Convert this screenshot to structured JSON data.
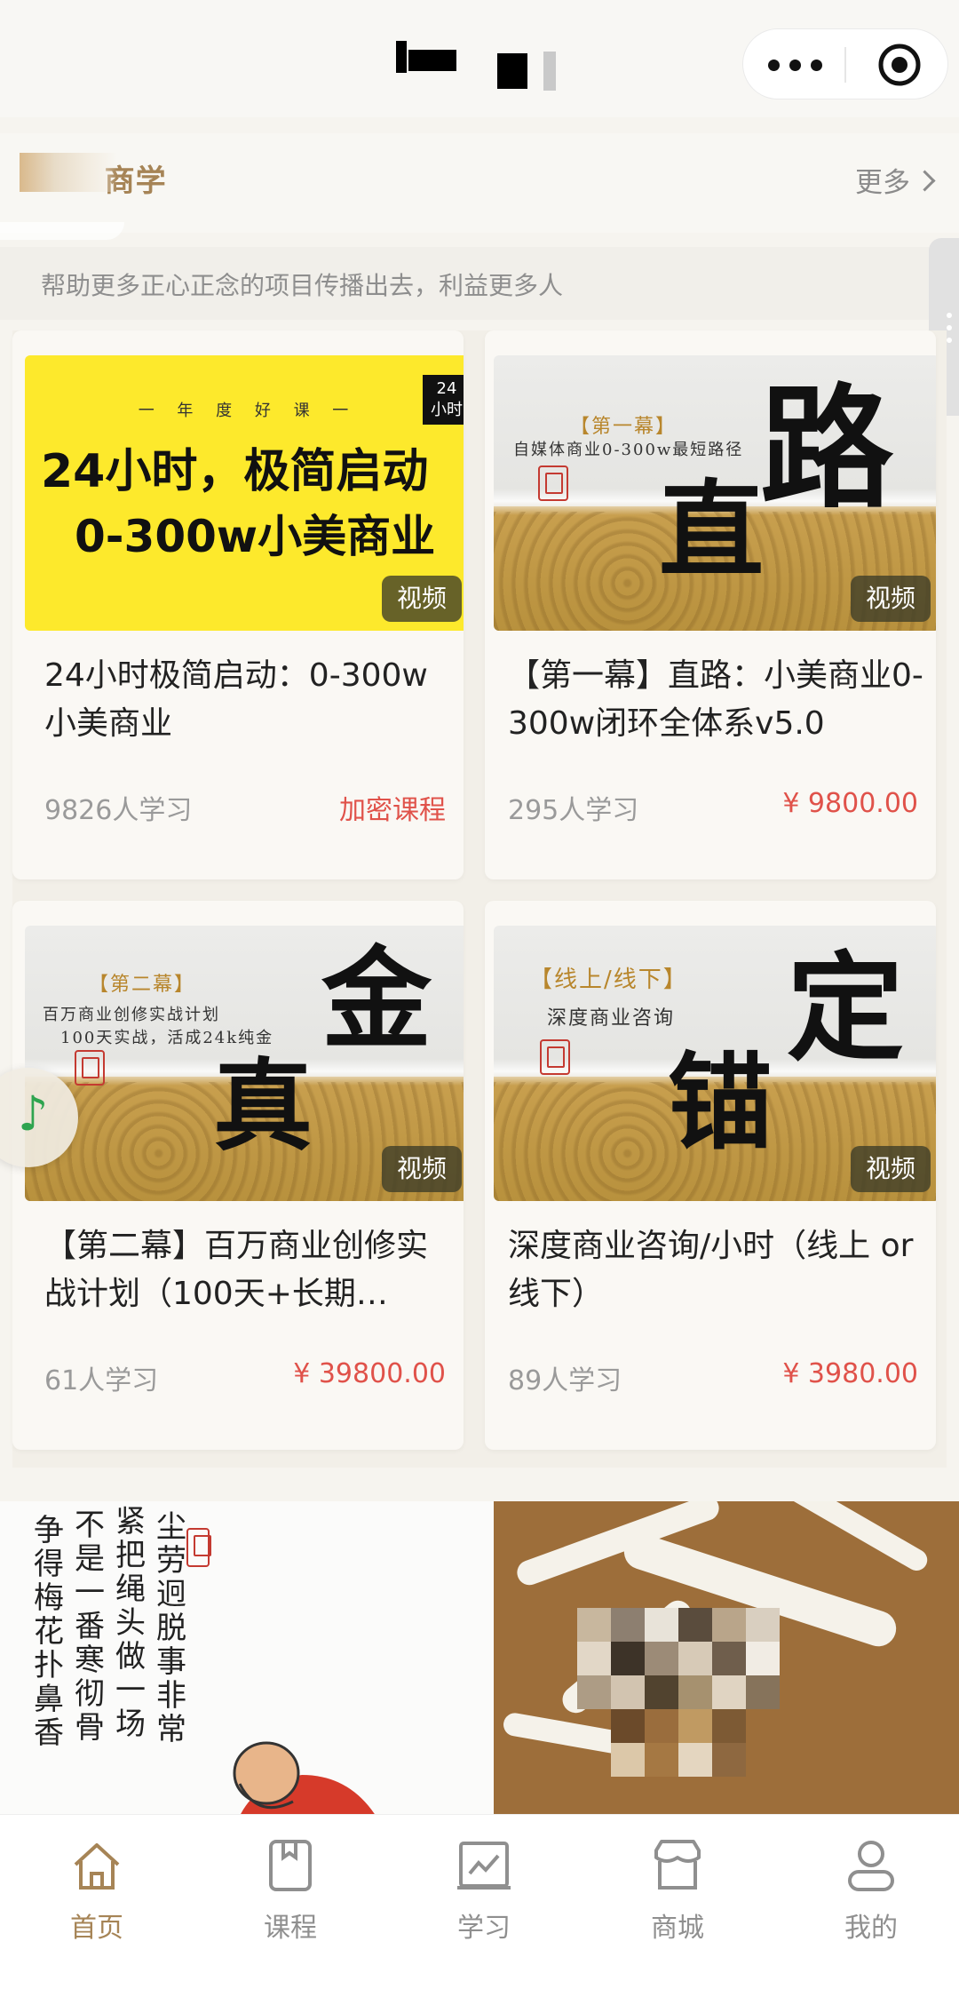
{
  "header": {
    "title": "",
    "more_icon": "more-dots-icon",
    "close_icon": "target-icon"
  },
  "section": {
    "title": "商学",
    "more_label": "更多",
    "subtitle": "帮助更多正心正念的项目传播出去，利益更多人"
  },
  "courses": [
    {
      "title": "24小时极简启动：0-300w小美商业",
      "learners": "9826人学习",
      "price": "加密课程",
      "media_tag": "视频",
      "thumb": {
        "tag": "一 年 度 好 课 一",
        "line1": "24小时，极简启动",
        "line2": "0-300w小美商业",
        "badge_top": "24",
        "badge_bottom": "小时"
      }
    },
    {
      "title": "【第一幕】直路：小美商业0-300w闭环全体系v5.0",
      "learners": "295人学习",
      "price": "¥ 9800.00",
      "media_tag": "视频",
      "thumb": {
        "tag": "【第一幕】",
        "line1": "自媒体商业0-300w最短路径",
        "big1": "路",
        "big2": "直"
      }
    },
    {
      "title": "【第二幕】百万商业创修实战计划（100天+长期…",
      "learners": "61人学习",
      "price": "¥ 39800.00",
      "media_tag": "视频",
      "thumb": {
        "tag": "【第二幕】",
        "line1": "百万商业创修实战计划",
        "line2": "100天实战，活成24k纯金",
        "big1": "金",
        "big2": "真"
      }
    },
    {
      "title": "深度商业咨询/小时（线上 or 线下）",
      "learners": "89人学习",
      "price": "¥ 3980.00",
      "media_tag": "视频",
      "thumb": {
        "tag": "【线上/线下】",
        "line1": "深度商业咨询",
        "big1": "定",
        "big2": "锚"
      }
    }
  ],
  "banner": {
    "calligraphy": [
      "争得梅花扑鼻香",
      "不是一番寒彻骨",
      "紧把绳头做一场",
      "尘劳迥脱事非常"
    ]
  },
  "tabs": [
    {
      "label": "首页",
      "icon": "home-icon",
      "active": true
    },
    {
      "label": "课程",
      "icon": "book-icon",
      "active": false
    },
    {
      "label": "学习",
      "icon": "chart-icon",
      "active": false
    },
    {
      "label": "商城",
      "icon": "store-icon",
      "active": false
    },
    {
      "label": "我的",
      "icon": "user-icon",
      "active": false
    }
  ],
  "colors": {
    "accent": "#a68456",
    "price": "#e0524a",
    "muted": "#9a9a9a",
    "thumb_yellow": "#fde92c"
  }
}
